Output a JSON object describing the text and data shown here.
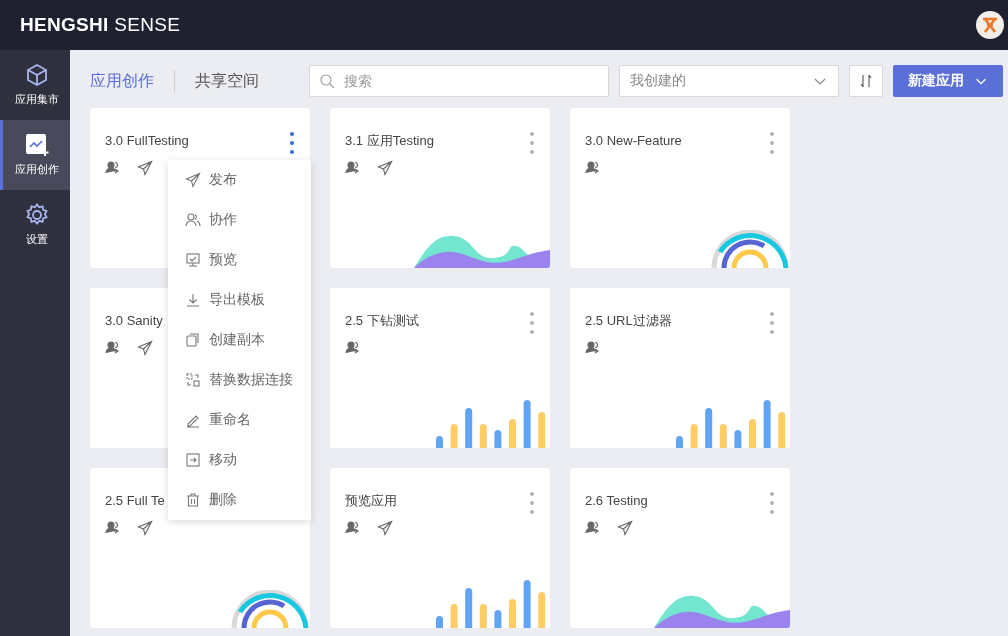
{
  "topbar": {
    "logo": "**HENGSHI** SENSE"
  },
  "sidebar": {
    "items": [
      {
        "label": "应用集市",
        "kind": "market",
        "selected": false
      },
      {
        "label": "应用创作",
        "kind": "create",
        "selected": true
      },
      {
        "label": "设置",
        "kind": "settings",
        "selected": false
      }
    ]
  },
  "tabs": [
    {
      "label": "应用创作",
      "selected": true
    },
    {
      "label": "共享空间",
      "selected": false
    }
  ],
  "search": {
    "placeholder": "搜索"
  },
  "filter": {
    "value": "我创建的"
  },
  "new_button": {
    "label": "新建应用"
  },
  "apps": [
    {
      "title": "3.0 FullTesting",
      "menu_open": true,
      "published": true,
      "kind": "plain"
    },
    {
      "title": "3.1 应用Testing",
      "menu_open": false,
      "published": true,
      "kind": "area"
    },
    {
      "title": "3.0 New-Feature",
      "menu_open": false,
      "published": false,
      "kind": "rings"
    },
    {
      "title": "3.0 Sanity",
      "menu_open": false,
      "published": true,
      "kind": "plain"
    },
    {
      "title": "2.5 下钻测试",
      "menu_open": false,
      "published": false,
      "kind": "bars"
    },
    {
      "title": "2.5 URL过滤器",
      "menu_open": false,
      "published": false,
      "kind": "bars"
    },
    {
      "title": "2.5 Full Te",
      "menu_open": false,
      "published": true,
      "kind": "rings"
    },
    {
      "title": "预览应用",
      "menu_open": false,
      "published": true,
      "kind": "bars"
    },
    {
      "title": "2.6 Testing",
      "menu_open": false,
      "published": true,
      "kind": "area"
    }
  ],
  "context_menu": {
    "items": [
      {
        "label": "发布",
        "kind": "publish"
      },
      {
        "label": "协作",
        "kind": "collaborate"
      },
      {
        "label": "预览",
        "kind": "preview"
      },
      {
        "label": "导出模板",
        "kind": "export"
      },
      {
        "label": "创建副本",
        "kind": "copy"
      },
      {
        "label": "替换数据连接",
        "kind": "replace"
      },
      {
        "label": "重命名",
        "kind": "rename"
      },
      {
        "label": "移动",
        "kind": "move"
      },
      {
        "label": "删除",
        "kind": "delete"
      }
    ]
  }
}
